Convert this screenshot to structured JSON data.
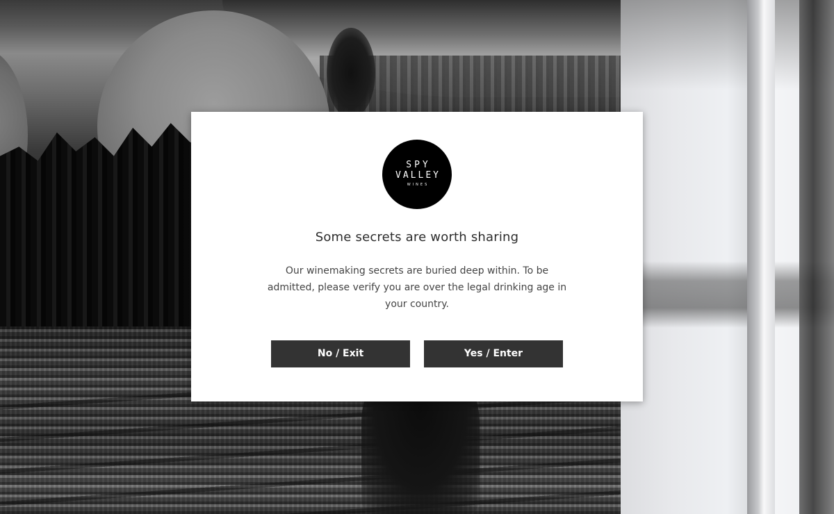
{
  "modal": {
    "logo": {
      "line1": "SPY",
      "line2": "VALLEY",
      "line3": "WINES"
    },
    "title": "Some secrets are worth sharing",
    "message": "Our winemaking secrets are buried deep within. To be admitted, please verify you are over the legal drinking age in your country.",
    "buttons": {
      "no_label": "No / Exit",
      "yes_label": "Yes / Enter"
    }
  },
  "colors": {
    "modal_background": "#ffffff",
    "button_background": "#333333",
    "button_text": "#ffffff",
    "title_text": "#2c2c2c",
    "body_text": "#444444",
    "logo_background": "#000000"
  }
}
